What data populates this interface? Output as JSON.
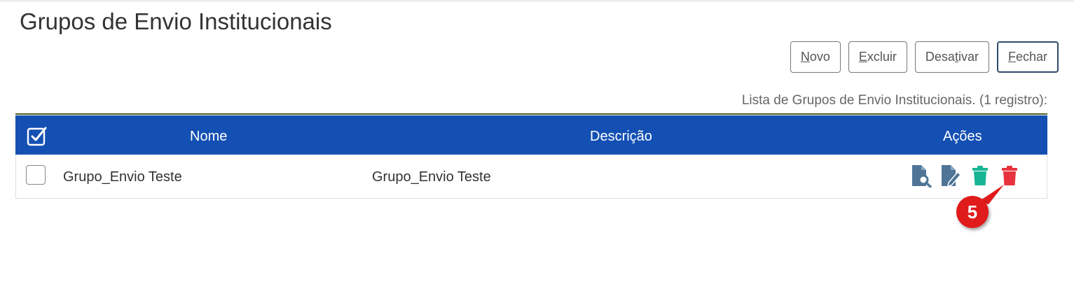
{
  "page": {
    "title": "Grupos de Envio Institucionais"
  },
  "toolbar": {
    "buttons": [
      {
        "acc": "N",
        "rest": "ovo",
        "pre": ""
      },
      {
        "acc": "E",
        "rest": "xcluir",
        "pre": ""
      },
      {
        "pre": "Desa",
        "acc": "t",
        "rest": "ivar"
      },
      {
        "acc": "F",
        "rest": "echar",
        "pre": ""
      }
    ]
  },
  "table": {
    "caption": "Lista de Grupos de Envio Institucionais. (1 registro):",
    "headers": {
      "name": "Nome",
      "description": "Descrição",
      "actions": "Ações"
    },
    "rows": [
      {
        "name": "Grupo_Envio Teste",
        "description": "Grupo_Envio Teste"
      }
    ],
    "action_icons": [
      "document-search-icon",
      "document-edit-icon",
      "trash-green-icon",
      "trash-red-icon"
    ]
  },
  "annotation": {
    "step": "5"
  },
  "colors": {
    "header_bg": "#1450b3",
    "action_blue": "#4f7496",
    "trash_green": "#17b594",
    "trash_red": "#e8333f",
    "badge_red": "#e01b1b"
  }
}
